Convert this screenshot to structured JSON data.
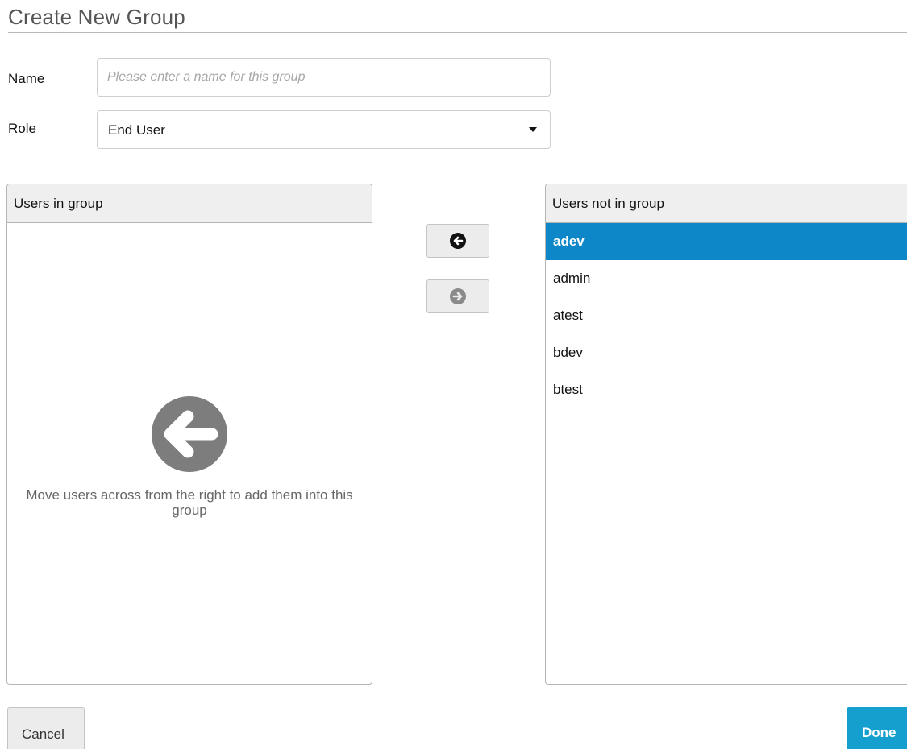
{
  "dialog": {
    "title": "Create New Group"
  },
  "form": {
    "name_label": "Name",
    "name_value": "",
    "name_placeholder": "Please enter a name for this group",
    "role_label": "Role",
    "role_value": "End User"
  },
  "left_panel": {
    "header": "Users in group",
    "empty_icon": "arrow-left-circle-icon",
    "empty_message": "Move users across from the right to add them into this group"
  },
  "right_panel": {
    "header": "Users not in group",
    "items": [
      {
        "label": "adev",
        "selected": true
      },
      {
        "label": "admin",
        "selected": false
      },
      {
        "label": "atest",
        "selected": false
      },
      {
        "label": "bdev",
        "selected": false
      },
      {
        "label": "btest",
        "selected": false
      }
    ]
  },
  "transfer": {
    "add_icon": "arrow-left-circle-icon",
    "remove_icon": "arrow-right-circle-icon",
    "add_enabled": true,
    "remove_enabled": false
  },
  "footer": {
    "cancel_label": "Cancel",
    "done_label": "Done"
  },
  "colors": {
    "selection": "#0d87c8",
    "primary_button": "#149fcf",
    "muted_icon": "#7d7d7d"
  }
}
